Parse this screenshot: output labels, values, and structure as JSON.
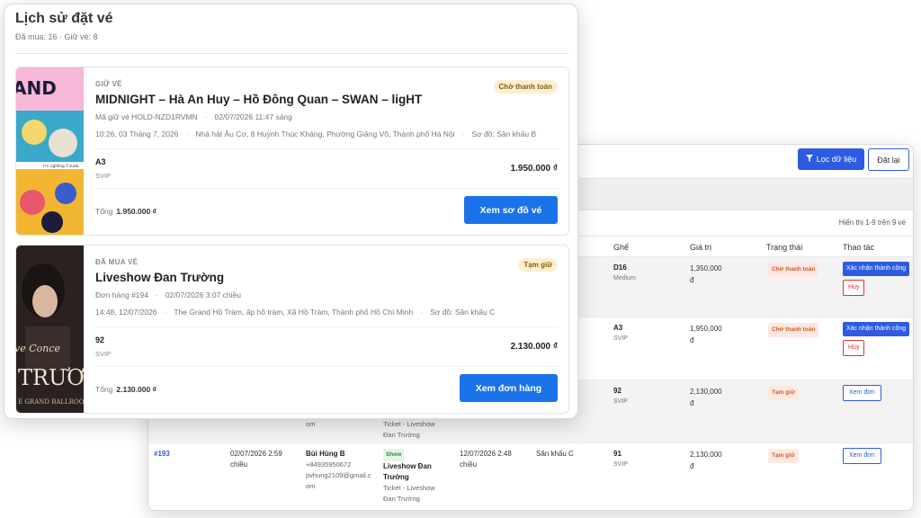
{
  "admin": {
    "filter_label": "Lọc dữ liệu",
    "reset_label": "Đặt lại",
    "showing": "Hiển thị 1-9 trên 9 vé",
    "headers": {
      "seat": "Ghế",
      "value": "Giá trị",
      "status": "Trạng thái",
      "actions": "Thao tác"
    },
    "rows": [
      {
        "seat": "D16",
        "seat_type": "Medium",
        "price": "1,350,000",
        "currency": "đ",
        "status": "Chờ thanh toán",
        "confirm": "Xác nhận thành công",
        "cancel": "Hủy"
      },
      {
        "seat": "A3",
        "seat_type": "SVIP",
        "price": "1,950,000",
        "currency": "đ",
        "status": "Chờ thanh toán",
        "confirm": "Xác nhận thành công",
        "cancel": "Hủy"
      },
      {
        "seat": "92",
        "seat_type": "SVIP",
        "price": "2,130,000",
        "currency": "đ",
        "status": "Tạm giữ",
        "view": "Xem đơn",
        "frag_email_tail": "om",
        "frag_ticket": "Ticket - Liveshow",
        "frag_event": "Đan Trường"
      },
      {
        "order": "#193",
        "date_line1": "02/07/2026 2:59",
        "date_line2": "chiều",
        "customer": "Bùi Hùng B",
        "phone": "+84935950672",
        "email_line1": "pvhung2109@gmail.c",
        "email_line2": "om",
        "tag": "Show",
        "event_line1": "Liveshow Đan",
        "event_line2": "Trường",
        "ticket_line1": "Ticket - Liveshow",
        "ticket_line2": "Đan Trường",
        "show_time_line1": "12/07/2026 2:48",
        "show_time_line2": "chiều",
        "stage": "Sân khấu C",
        "seat": "91",
        "seat_type": "SVIP",
        "price": "2,130,000",
        "currency": "đ",
        "status": "Tạm giữ",
        "view": "Xem đơn"
      }
    ]
  },
  "history": {
    "title": "Lịch sử đặt vé",
    "counts": "Đã mua: 16 · Giữ vé: 8",
    "cards": [
      {
        "kind": "GIỮ VÉ",
        "name": "MIDNIGHT – Hà An Huy – Hồ Đông Quan – SWAN – ligHT",
        "code": "Mã giữ vé HOLD-NZD1RVMN",
        "created": "02/07/2026 11:47 sáng",
        "time": "10:26, 03 Tháng 7, 2026",
        "venue": "Nhà hát Âu Cơ, 8 Huỳnh Thúc Kháng, Phường Giảng Võ, Thành phố Hà Nội",
        "map": "Sơ đồ: Sân khấu B",
        "badge": "Chờ thanh toán",
        "seat": "A3",
        "seat_type": "SVIP",
        "price": "1.950.000 ₫",
        "total_label": "Tổng",
        "total": "1.950.000 ₫",
        "cta": "Xem sơ đồ vé",
        "art_text_1": "AND",
        "art_text_2": "I'm Lighting !f sun&"
      },
      {
        "kind": "ĐÃ MUA VÉ",
        "name": "Liveshow Đan Trường",
        "code": "Đơn hàng #194",
        "created": "02/07/2026 3:07 chiều",
        "time": "14:48, 12/07/2026",
        "venue": "The Grand Hồ Tràm, ấp hồ tràm, Xã Hồ Tràm, Thành phố Hồ Chí Minh",
        "map": "Sơ đồ: Sân khấu C",
        "badge": "Tạm giữ",
        "seat": "92",
        "seat_type": "SVIP",
        "price": "2.130.000 ₫",
        "total_label": "Tổng",
        "total": "2.130.000 ₫",
        "cta": "Xem đơn hàng",
        "art_text_1": "ve Conce",
        "art_text_2": "TRƯƠ",
        "art_text_3": "E GRAND BALLROO"
      }
    ]
  },
  "colors": {
    "primary": "#1a73e8",
    "admin_primary": "#2d5be3",
    "badge_bg": "#fbefd0",
    "badge_text": "#8a5a06",
    "danger": "#dd3333"
  },
  "icons": {
    "filter": "filter-icon"
  }
}
